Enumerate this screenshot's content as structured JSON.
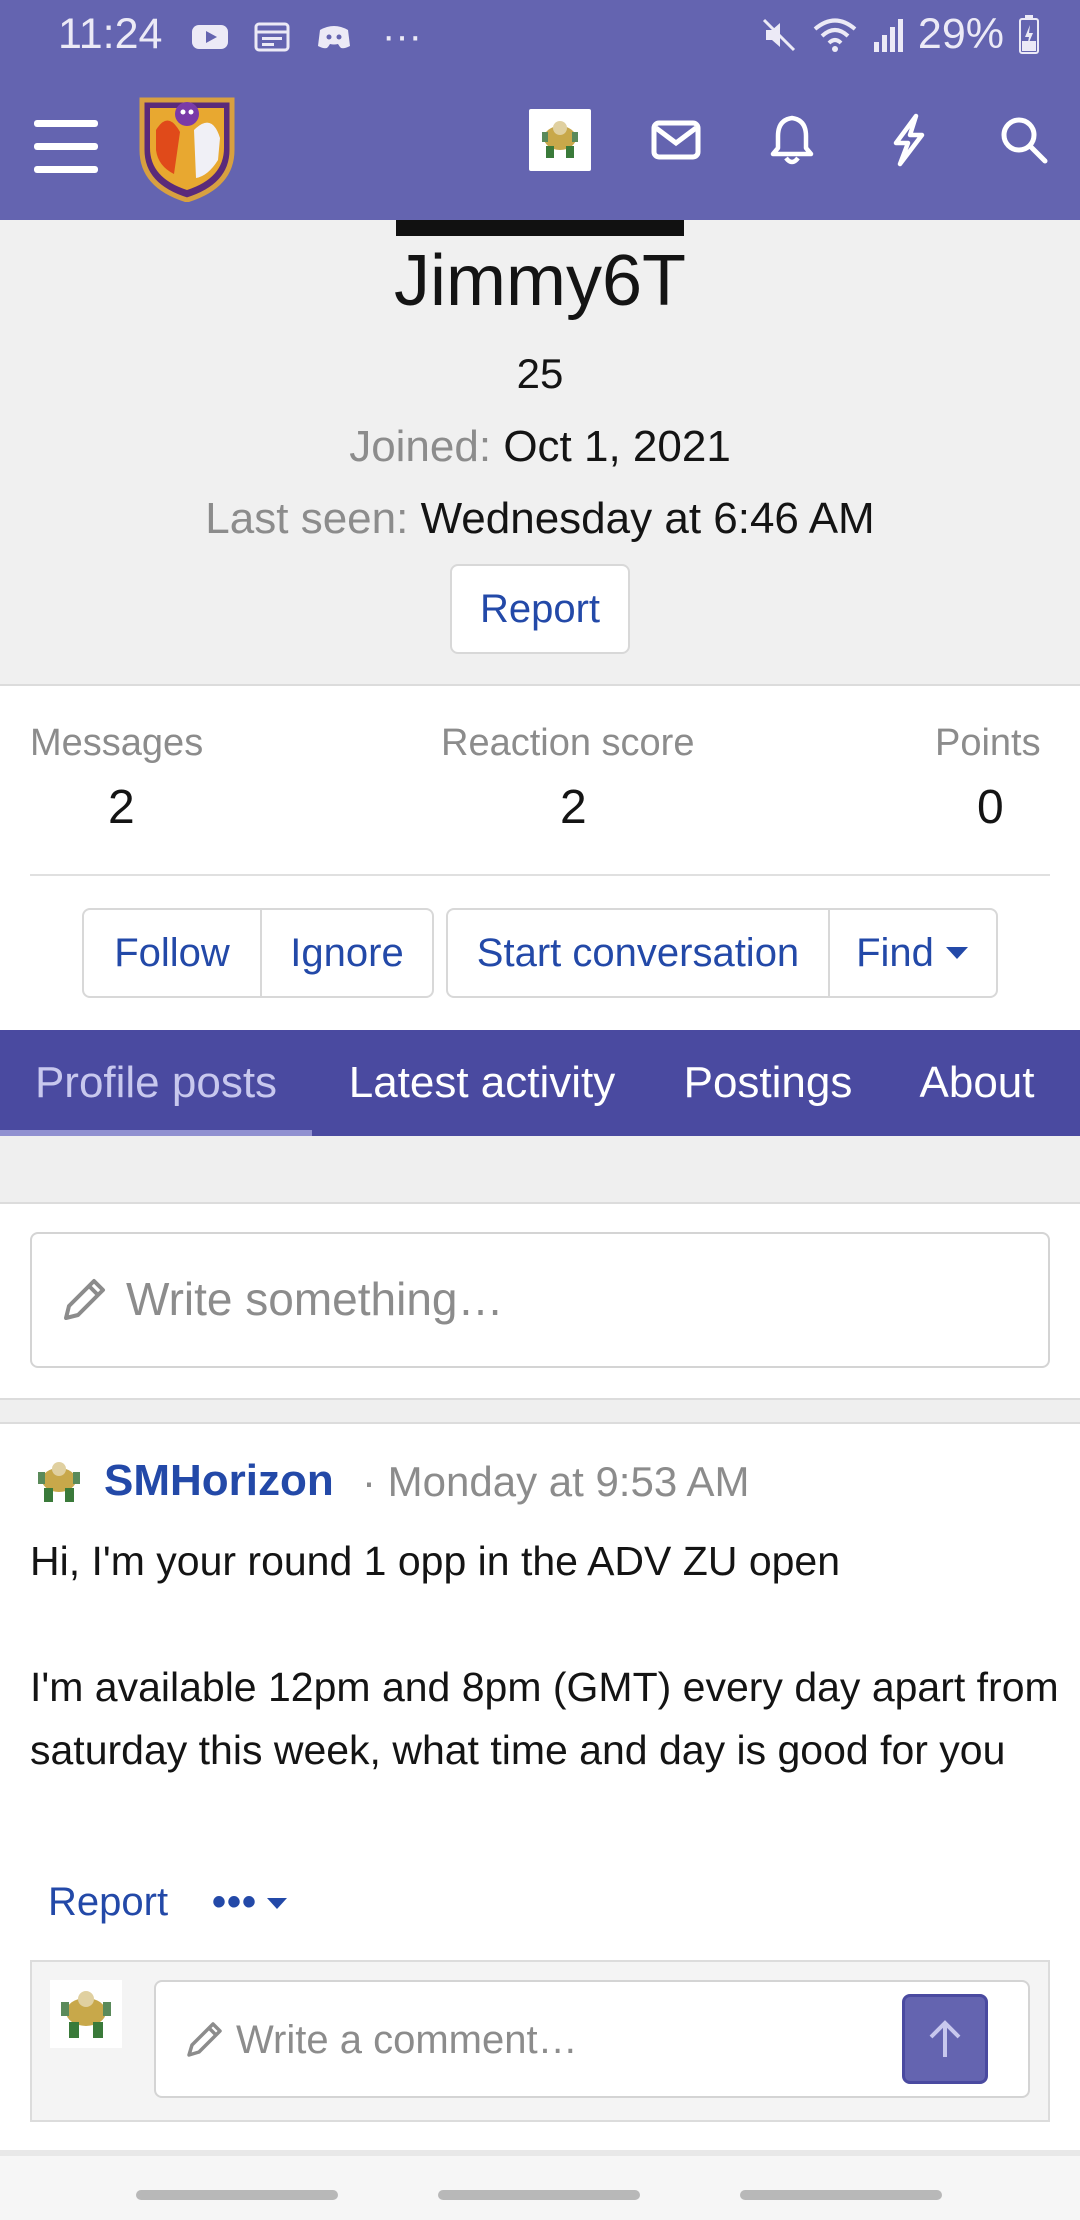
{
  "status_bar": {
    "time": "11:24",
    "more": "···",
    "battery": "29%"
  },
  "header": {
    "icons": [
      "menu-icon",
      "site-logo",
      "user-avatar",
      "mail-icon",
      "bell-icon",
      "bolt-icon",
      "search-icon"
    ]
  },
  "profile": {
    "username": "Jimmy6T",
    "subtitle": "25",
    "joined_label": "Joined:",
    "joined_value": "Oct 1, 2021",
    "last_seen_label": "Last seen:",
    "last_seen_value": "Wednesday at 6:46 AM",
    "report_label": "Report"
  },
  "stats": [
    {
      "label": "Messages",
      "value": "2"
    },
    {
      "label": "Reaction score",
      "value": "2"
    },
    {
      "label": "Points",
      "value": "0"
    }
  ],
  "actions": {
    "follow": "Follow",
    "ignore": "Ignore",
    "start_conversation": "Start conversation",
    "find": "Find"
  },
  "tabs": [
    {
      "label": "Profile posts",
      "active": true
    },
    {
      "label": "Latest activity",
      "active": false
    },
    {
      "label": "Postings",
      "active": false
    },
    {
      "label": "About",
      "active": false
    }
  ],
  "composer": {
    "placeholder": "Write something…"
  },
  "post": {
    "author": "SMHorizon",
    "time": "· Monday at 9:53 AM",
    "body_line1": "Hi, I'm your round 1 opp in the ADV ZU open",
    "body_line2": "I'm available 12pm and 8pm (GMT) every day apart from saturday this week, what time and day is good for you",
    "report_label": "Report",
    "more_label": "•••"
  },
  "comment": {
    "placeholder": "Write a comment…"
  },
  "colors": {
    "header": "#6464b0",
    "tabs": "#4a4aa0",
    "link": "#2349a8"
  }
}
